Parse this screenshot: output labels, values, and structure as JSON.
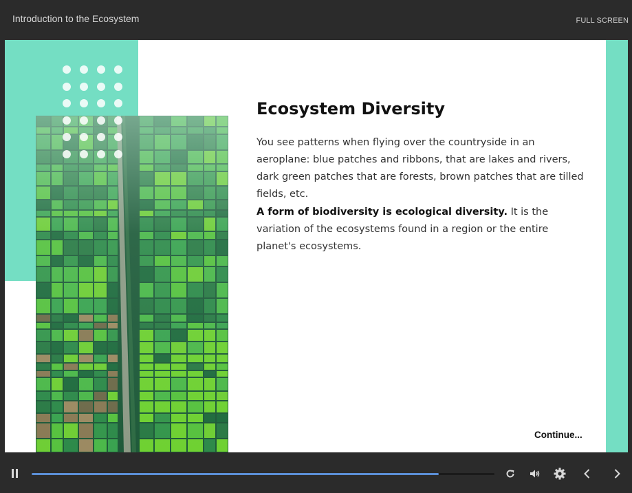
{
  "header": {
    "course_title": "Introduction to the Ecosystem",
    "fullscreen_label": "FULL SCREEN"
  },
  "slide": {
    "heading": "Ecosystem Diversity",
    "paragraph1": "You see patterns when flying over the countryside in an aeroplane: blue patches and ribbons, that are lakes and rivers, dark green patches that are forests, brown patches that are tilled fields, etc.",
    "paragraph2_bold": "A form of biodiversity is ecological diversity.",
    "paragraph2_rest": " It is the variation of the ecosystems found in a region or the entire planet's ecosystems.",
    "continue_label": "Continue...",
    "image_subject": "aerial-farmland-photo",
    "accent_color": "#74dec3"
  },
  "player": {
    "progress": 0.88,
    "icons": [
      "pause-icon",
      "replay-icon",
      "volume-icon",
      "settings-icon",
      "previous-icon",
      "next-icon"
    ],
    "progress_color": "#5b8fd6"
  }
}
